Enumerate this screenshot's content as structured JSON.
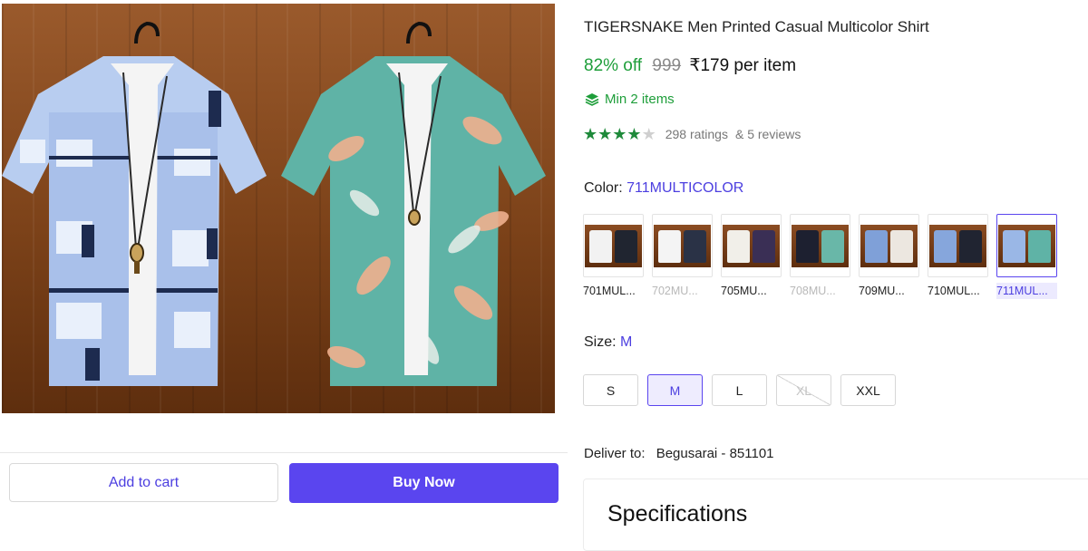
{
  "product": {
    "title": "TIGERSNAKE Men Printed Casual Multicolor Shirt",
    "discount": "82% off",
    "mrp": "999",
    "price": "₹179 per item",
    "min_items": "Min 2 items",
    "ratings": "298 ratings",
    "reviews": "& 5 reviews",
    "star_rating": 4,
    "star_max": 5
  },
  "color": {
    "label": "Color:",
    "selected": "711MULTICOLOR",
    "options": [
      {
        "label": "701MUL...",
        "state": "normal",
        "colors": [
          "#f2f2f2",
          "#202530"
        ]
      },
      {
        "label": "702MU...",
        "state": "unavailable",
        "colors": [
          "#f4f4f4",
          "#2a3246"
        ]
      },
      {
        "label": "705MU...",
        "state": "normal",
        "colors": [
          "#f1efe9",
          "#3a2f55"
        ]
      },
      {
        "label": "708MU...",
        "state": "unavailable",
        "colors": [
          "#1d2030",
          "#69b7a8"
        ]
      },
      {
        "label": "709MU...",
        "state": "normal",
        "colors": [
          "#7fa0d8",
          "#ece7e0"
        ]
      },
      {
        "label": "710MUL...",
        "state": "normal",
        "colors": [
          "#86a6dc",
          "#202431"
        ]
      },
      {
        "label": "711MUL...",
        "state": "selected",
        "colors": [
          "#9ab7e6",
          "#5fb3a6"
        ]
      }
    ]
  },
  "size": {
    "label": "Size:",
    "selected": "M",
    "options": [
      {
        "label": "S",
        "state": "normal"
      },
      {
        "label": "M",
        "state": "selected"
      },
      {
        "label": "L",
        "state": "normal"
      },
      {
        "label": "XL",
        "state": "unavailable"
      },
      {
        "label": "XXL",
        "state": "normal"
      }
    ]
  },
  "delivery": {
    "label": "Deliver to:",
    "location": "Begusarai - 851101"
  },
  "actions": {
    "add_to_cart": "Add to cart",
    "buy_now": "Buy Now"
  },
  "specifications": {
    "title": "Specifications"
  },
  "colors": {
    "accent": "#5a45ef",
    "green": "#1e9e3a",
    "star": "#1e8a3a"
  }
}
